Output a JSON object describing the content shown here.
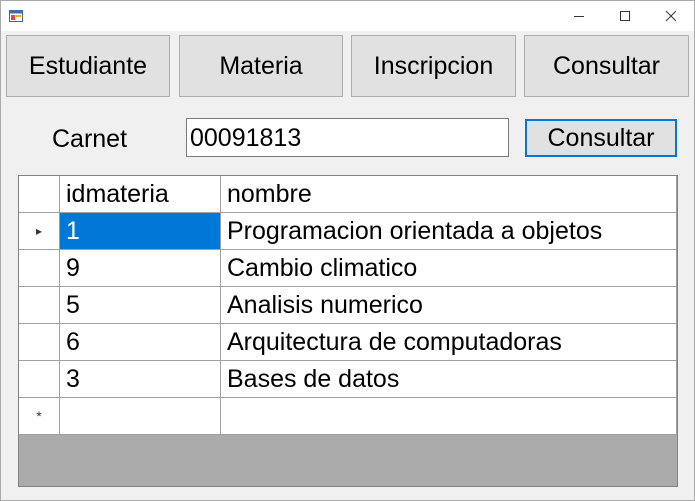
{
  "window": {
    "title": "",
    "controls": {
      "minimize": "—",
      "maximize": "☐",
      "close": "✕"
    }
  },
  "tabs": [
    {
      "label": "Estudiante"
    },
    {
      "label": "Materia"
    },
    {
      "label": "Inscripcion"
    },
    {
      "label": "Consultar"
    }
  ],
  "form": {
    "carnet_label": "Carnet",
    "carnet_value": "00091813",
    "consult_button": "Consultar"
  },
  "grid": {
    "columns": [
      "idmateria",
      "nombre"
    ],
    "rows": [
      {
        "idmateria": "1",
        "nombre": "Programacion orientada a objetos",
        "selected": true
      },
      {
        "idmateria": "9",
        "nombre": "Cambio climatico"
      },
      {
        "idmateria": "5",
        "nombre": "Analisis numerico"
      },
      {
        "idmateria": "6",
        "nombre": "Arquitectura de computadoras"
      },
      {
        "idmateria": "3",
        "nombre": "Bases de datos"
      }
    ],
    "current_row_indicator": "▸",
    "new_row_indicator": "*"
  }
}
